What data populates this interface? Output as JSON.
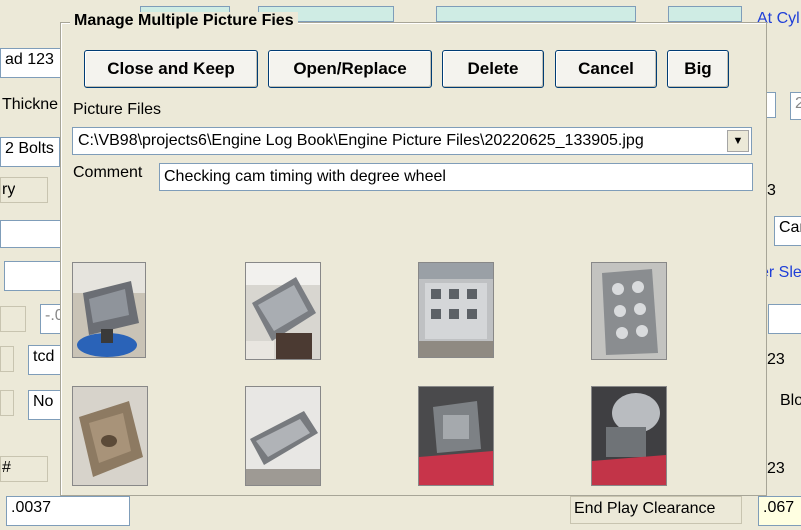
{
  "dialog": {
    "title": "Manage Multiple Picture Fies",
    "buttons": {
      "close_keep": "Close and Keep",
      "open_replace": "Open/Replace",
      "delete": "Delete",
      "cancel": "Cancel",
      "big": "Big"
    },
    "picture_files_label": "Picture Files",
    "selected_file": "C:\\VB98\\projects6\\Engine Log Book\\Engine Picture Files\\20220625_133905.jpg",
    "comment_label": "Comment",
    "comment_value": "Checking cam timing with degree wheel",
    "thumbnails": [
      {
        "name": "engine-block-blue-stand"
      },
      {
        "name": "engine-top-view"
      },
      {
        "name": "cylinder-head-valves"
      },
      {
        "name": "engine-valvetrain"
      },
      {
        "name": "bare-block-casting"
      },
      {
        "name": "engine-side-view"
      },
      {
        "name": "engine-on-stand-red-floor"
      },
      {
        "name": "engine-assembly-red-floor"
      }
    ]
  },
  "background": {
    "field_ad": "ad 123",
    "label_thickness": "Thickne",
    "field_bolts": "2 Bolts",
    "label_ry": "ry",
    "field_minus": "-.0",
    "field_tcd": "tcd",
    "field_no": "No",
    "label_hash": "#",
    "field_0037": ".0037",
    "label_end_play": "End Play Clearance",
    "field_067": ".067",
    "label_at_cyl": "At Cyl",
    "label_er_sle": "er Sle",
    "label_car": "Car",
    "label_3": "3",
    "label_23a": "23",
    "label_blo": "Blo",
    "label_23b": "23",
    "field_2": "2"
  }
}
